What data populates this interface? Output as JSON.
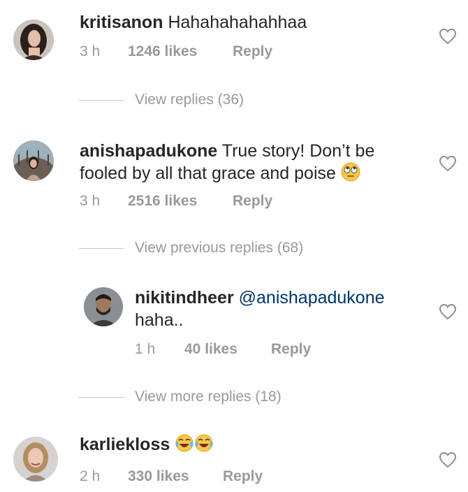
{
  "comments": [
    {
      "username": "kritisanon",
      "text": "Hahahahahahhaa",
      "time": "3 h",
      "likes": "1246 likes",
      "reply": "Reply",
      "emojis": []
    },
    {
      "username": "anishapadukone",
      "text": "True story! Don’t be fooled by all that grace and poise",
      "time": "3 h",
      "likes": "2516 likes",
      "reply": "Reply",
      "emojis": [
        "face-with-rolling-eyes"
      ]
    },
    {
      "username": "nikitindheer",
      "text": "@anishapadukone haha..",
      "mention": "@anishapadukone",
      "text_after": "haha..",
      "time": "1 h",
      "likes": "40 likes",
      "reply": "Reply",
      "emojis": []
    },
    {
      "username": "karliekloss",
      "text": "",
      "time": "2 h",
      "likes": "330 likes",
      "reply": "Reply",
      "emojis": [
        "face-with-tears-of-joy",
        "face-with-tears-of-joy"
      ]
    }
  ],
  "reply_links": {
    "view_replies": "View replies (36)",
    "view_previous_replies": "View previous replies (68)",
    "view_more_replies": "View more replies (18)"
  },
  "icons": {
    "like": "heart-outline-icon"
  },
  "colors": {
    "text": "#262626",
    "muted": "#999999",
    "mention": "#003569",
    "background": "#ffffff"
  }
}
